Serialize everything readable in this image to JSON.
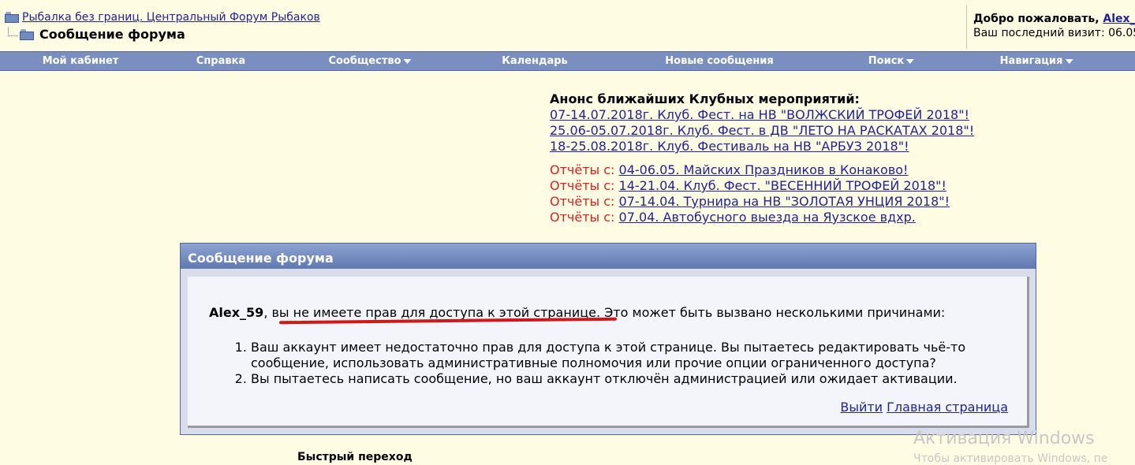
{
  "header": {
    "forum_link": "Рыбалка без границ. Центральный Форум Рыбаков",
    "page_title": "Сообщение форума",
    "welcome_prefix": "Добро пожаловать, ",
    "welcome_user": "Alex_",
    "last_visit": "Ваш последний визит: 06.05"
  },
  "nav": {
    "items": [
      {
        "label": "Мой кабинет"
      },
      {
        "label": "Справка"
      },
      {
        "label": "Сообщество"
      },
      {
        "label": "Календарь"
      },
      {
        "label": "Новые сообщения"
      },
      {
        "label": "Поиск"
      },
      {
        "label": "Навигация"
      }
    ]
  },
  "announcements": {
    "heading": "Анонс ближайших Клубных мероприятий:",
    "events": [
      "07-14.07.2018г. Клуб. Фест. на НВ \"ВОЛЖСКИЙ ТРОФЕЙ 2018\"!",
      "25.06-05.07.2018г. Клуб. Фест. в ДВ \"ЛЕТО НА РАСКАТАХ 2018\"!",
      "18-25.08.2018г. Клуб. Фестиваль на НВ \"АРБУЗ 2018\"!"
    ],
    "report_prefix": "Отчёты с: ",
    "reports": [
      "04-06.05. Майских Праздников в Конаково!",
      "14-21.04. Клуб. Фест. \"ВЕСЕННИЙ ТРОФЕЙ 2018\"!",
      "07-14.04. Турнира на НВ \"ЗОЛОТАЯ УНЦИЯ 2018\"!",
      "07.04. Автобусного выезда на Яузское вдхр."
    ]
  },
  "message": {
    "title": "Сообщение форума",
    "username": "Alex_59",
    "no_access": ", вы не имеете прав для доступа к этой странице.",
    "reasons_intro": " Это может быть вызвано несколькими причинами:",
    "reasons": [
      "Ваш аккаунт имеет недостаточно прав для доступа к этой странице. Вы пытаетесь редактировать чьё-то сообщение, использовать административные полномочия или прочие опции ограниченного доступа?",
      "Вы пытаетесь написать сообщение, но ваш аккаунт отключён администрацией или ожидает активации."
    ],
    "logout_link": "Выйти",
    "home_link": "Главная страница"
  },
  "footer": {
    "quick_nav": "Быстрый переход"
  },
  "watermark": {
    "line1": "Активация Windows",
    "line2": "Чтобы активировать Windows, пе"
  }
}
